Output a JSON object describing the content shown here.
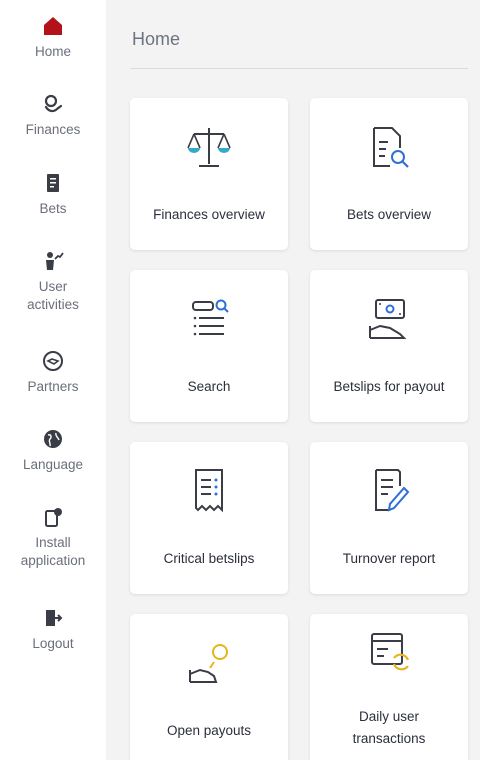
{
  "colors": {
    "accent_red": "#b3121a",
    "icon_dark": "#3a3d45",
    "icon_blue": "#2f6fd6",
    "icon_teal": "#35a9c8",
    "icon_gold": "#e4b520",
    "nav_label": "#6a6f7b"
  },
  "sidebar": {
    "items": [
      {
        "label": "Home",
        "icon": "home-icon"
      },
      {
        "label": "Finances",
        "icon": "finances-icon"
      },
      {
        "label": "Bets",
        "icon": "bets-icon"
      },
      {
        "label": "User activities",
        "icon": "user-activities-icon"
      },
      {
        "label": "Partners",
        "icon": "partners-icon"
      },
      {
        "label": "Language",
        "icon": "globe-icon"
      },
      {
        "label": "Install application",
        "icon": "install-app-icon"
      },
      {
        "label": "Logout",
        "icon": "logout-icon"
      }
    ]
  },
  "main": {
    "title": "Home",
    "tiles": [
      {
        "label": "Finances overview",
        "icon": "scale-icon"
      },
      {
        "label": "Bets overview",
        "icon": "document-search-icon"
      },
      {
        "label": "Search",
        "icon": "search-list-icon"
      },
      {
        "label": "Betslips for payout",
        "icon": "cash-hand-icon"
      },
      {
        "label": "Critical betslips",
        "icon": "receipt-icon"
      },
      {
        "label": "Turnover report",
        "icon": "edit-document-icon"
      },
      {
        "label": "Open payouts",
        "icon": "coin-hand-icon"
      },
      {
        "label": "Daily user transactions",
        "icon": "transactions-icon"
      }
    ]
  }
}
